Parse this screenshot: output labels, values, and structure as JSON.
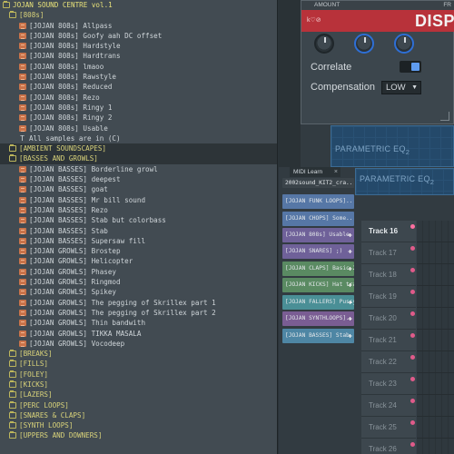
{
  "browser": {
    "items": [
      {
        "label": "JOJAN SOUND CENTRE vol.1",
        "type": "root",
        "level": 0
      },
      {
        "label": "[808s]",
        "type": "folder",
        "level": 1
      },
      {
        "label": "[JOJAN 808s] Allpass",
        "type": "file",
        "level": 2
      },
      {
        "label": "[JOJAN 808s] Goofy aah DC offset",
        "type": "file",
        "level": 2
      },
      {
        "label": "[JOJAN 808s] Hardstyle",
        "type": "file",
        "level": 2
      },
      {
        "label": "[JOJAN 808s] Hardtrans",
        "type": "file",
        "level": 2
      },
      {
        "label": "[JOJAN 808s] lmaoo",
        "type": "file",
        "level": 2
      },
      {
        "label": "[JOJAN 808s] Rawstyle",
        "type": "file",
        "level": 2
      },
      {
        "label": "[JOJAN 808s] Reduced",
        "type": "file",
        "level": 2
      },
      {
        "label": "[JOJAN 808s] Rezo",
        "type": "file",
        "level": 2
      },
      {
        "label": "[JOJAN 808s] Ringy 1",
        "type": "file",
        "level": 2
      },
      {
        "label": "[JOJAN 808s] Ringy 2",
        "type": "file",
        "level": 2
      },
      {
        "label": "[JOJAN 808s] Usable",
        "type": "file",
        "level": 2
      },
      {
        "label": "All samples are in (C)",
        "type": "info",
        "level": 2
      },
      {
        "label": "[AMBIENT SOUNDSCAPES]",
        "type": "folder",
        "level": 1,
        "selected": true
      },
      {
        "label": "[BASSES AND GROWLS]",
        "type": "folder",
        "level": 1,
        "selected": true
      },
      {
        "label": "[JOJAN BASSES] Borderline growl",
        "type": "file",
        "level": 2
      },
      {
        "label": "[JOJAN BASSES] deepest",
        "type": "file",
        "level": 2
      },
      {
        "label": "[JOJAN BASSES] goat",
        "type": "file",
        "level": 2
      },
      {
        "label": "[JOJAN BASSES] Mr bill sound",
        "type": "file",
        "level": 2
      },
      {
        "label": "[JOJAN BASSES] Rezo",
        "type": "file",
        "level": 2
      },
      {
        "label": "[JOJAN BASSES] Stab but colorbass",
        "type": "file",
        "level": 2
      },
      {
        "label": "[JOJAN BASSES] Stab",
        "type": "file",
        "level": 2
      },
      {
        "label": "[JOJAN BASSES] Supersaw fill",
        "type": "file",
        "level": 2
      },
      {
        "label": "[JOJAN GROWLS] Brostep",
        "type": "file",
        "level": 2
      },
      {
        "label": "[JOJAN GROWLS] Helicopter",
        "type": "file",
        "level": 2
      },
      {
        "label": "[JOJAN GROWLS] Phasey",
        "type": "file",
        "level": 2
      },
      {
        "label": "[JOJAN GROWLS] Ringmod",
        "type": "file",
        "level": 2
      },
      {
        "label": "[JOJAN GROWLS] Spikey",
        "type": "file",
        "level": 2
      },
      {
        "label": "[JOJAN GROWLS] The pegging of Skrillex part 1",
        "type": "file",
        "level": 2
      },
      {
        "label": "[JOJAN GROWLS] The pegging of Skrillex part 2",
        "type": "file",
        "level": 2
      },
      {
        "label": "[JOJAN GROWLS] Thin bandwith",
        "type": "file",
        "level": 2
      },
      {
        "label": "[JOJAN GROWLS] TIKKA MASALA",
        "type": "file",
        "level": 2
      },
      {
        "label": "[JOJAN GROWLS] Vocodeep",
        "type": "file",
        "level": 2
      },
      {
        "label": "[BREAKS]",
        "type": "folder",
        "level": 1
      },
      {
        "label": "[FILLS]",
        "type": "folder",
        "level": 1
      },
      {
        "label": "[FOLEY]",
        "type": "folder",
        "level": 1
      },
      {
        "label": "[KICKS]",
        "type": "folder",
        "level": 1
      },
      {
        "label": "[LAZERS]",
        "type": "folder",
        "level": 1
      },
      {
        "label": "[PERC LOOPS]",
        "type": "folder",
        "level": 1
      },
      {
        "label": "[SNARES & CLAPS]",
        "type": "folder",
        "level": 1
      },
      {
        "label": "[SYNTH LOOPS]",
        "type": "folder",
        "level": 1
      },
      {
        "label": "[UPPERS AND DOWNERS]",
        "type": "folder",
        "level": 1
      }
    ]
  },
  "plugin": {
    "amount_label": "AMOUNT",
    "header_right": "FR",
    "logo": "k♡⊘",
    "brand": "DISP",
    "correlate_label": "Correlate",
    "compensation_label": "Compensation",
    "compensation_value": "LOW",
    "correlate_on": true
  },
  "eq": [
    {
      "label": "PARAMETRIC EQ",
      "sub": "2"
    },
    {
      "label": "PARAMETRIC EQ",
      "sub": "2"
    }
  ],
  "midi_learn": "MIDI Learn",
  "rack": {
    "channels": [
      {
        "label": "2002sound_KIT2_cra...",
        "color": "#3b444a",
        "plus": false
      },
      {
        "label": "[JOJAN FUNK LOOPS]...",
        "color": "#5677a6",
        "plus": false
      },
      {
        "label": "[JOJAN CHOPS] Some...",
        "color": "#5677a6",
        "plus": false
      },
      {
        "label": "[JOJAN 808s] Usable",
        "color": "#6f6199",
        "plus": true
      },
      {
        "label": "[JOJAN SNARES] ;)",
        "color": "#6f6199",
        "plus": true
      },
      {
        "label": "[JOJAN CLAPS] Basic 2",
        "color": "#5a8a62",
        "plus": true
      },
      {
        "label": "[JOJAN KICKS] Hat tra...",
        "color": "#5a8a62",
        "plus": true
      },
      {
        "label": "[JOJAN FALLERS] Pussy",
        "color": "#4a8f96",
        "plus": true
      },
      {
        "label": "[JOJAN SYNTHLOOPS]...",
        "color": "#7a5d93",
        "plus": true
      },
      {
        "label": "[JOJAN BASSES] Stab",
        "color": "#4e86a4",
        "plus": true
      }
    ]
  },
  "tracks": [
    {
      "label": "Track 16",
      "active": true
    },
    {
      "label": "Track 17",
      "active": false
    },
    {
      "label": "Track 18",
      "active": false
    },
    {
      "label": "Track 19",
      "active": false
    },
    {
      "label": "Track 20",
      "active": false
    },
    {
      "label": "Track 21",
      "active": false
    },
    {
      "label": "Track 22",
      "active": false
    },
    {
      "label": "Track 23",
      "active": false
    },
    {
      "label": "Track 24",
      "active": false
    },
    {
      "label": "Track 25",
      "active": false
    },
    {
      "label": "Track 26",
      "active": false
    }
  ]
}
